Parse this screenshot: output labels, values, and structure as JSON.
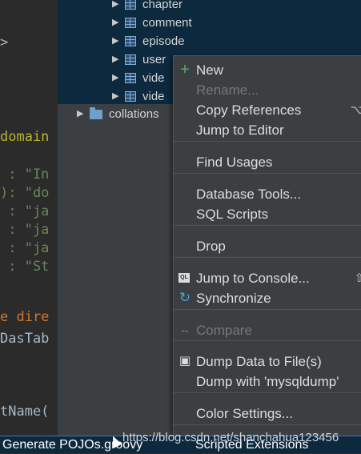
{
  "editor": {
    "lines": [
      {
        "text": ">",
        "cls": "c-plain"
      },
      {
        "text": "domain",
        "cls": "c-gold"
      },
      {
        "text": " : \"In",
        "cls": "c-str"
      },
      {
        "text": "): \"do",
        "cls": "c-str"
      },
      {
        "text": " : \"ja",
        "cls": "c-str"
      },
      {
        "text": " : \"ja",
        "cls": "c-str"
      },
      {
        "text": " : \"ja",
        "cls": "c-str"
      },
      {
        "text": " : \"St",
        "cls": "c-str"
      },
      {
        "text": "e dire",
        "cls": "c-orange"
      },
      {
        "text": "DasTab",
        "cls": "c-plain"
      },
      {
        "text": "tName(",
        "cls": "c-plain"
      }
    ]
  },
  "tree": {
    "tables": [
      "chapter",
      "comment",
      "episode",
      "user",
      "vide",
      "vide"
    ],
    "folder": "collations"
  },
  "menu": {
    "items": [
      {
        "label": "New",
        "icon": "plus-icon",
        "glyph": "+",
        "enabled": true
      },
      {
        "label": "Rename...",
        "enabled": false
      },
      {
        "label": "Copy References",
        "shortcut": "⌥",
        "enabled": true
      },
      {
        "label": "Jump to Editor",
        "enabled": true
      },
      {
        "label": "Find Usages",
        "enabled": true
      },
      {
        "label": "Database Tools...",
        "enabled": true
      },
      {
        "label": "SQL Scripts",
        "enabled": true
      },
      {
        "label": "Drop",
        "enabled": true
      },
      {
        "label": "Jump to Console...",
        "icon": "sql-console-icon",
        "glyph": "QL",
        "shortcut": "⇧",
        "enabled": true
      },
      {
        "label": "Synchronize",
        "icon": "sync-icon",
        "glyph": "↻",
        "enabled": true
      },
      {
        "label": "Compare",
        "icon": "compare-icon",
        "glyph": "↔",
        "enabled": false
      },
      {
        "label": "Dump Data to File(s)",
        "icon": "save-icon",
        "glyph": "▣",
        "enabled": true
      },
      {
        "label": "Dump with 'mysqldump'",
        "enabled": true
      },
      {
        "label": "Color Settings...",
        "enabled": true
      },
      {
        "label": "Scripted Extensions",
        "enabled": true
      }
    ]
  },
  "bottom": {
    "left_label": "Generate POJOs.groovy",
    "watermark": "https://blog.csdn.net/shanchahua123456"
  },
  "colors": {
    "selection": "#0d293e",
    "menu_bg": "#3c3f41",
    "new_icon": "#59a869",
    "sync_icon": "#4a9fe0"
  }
}
